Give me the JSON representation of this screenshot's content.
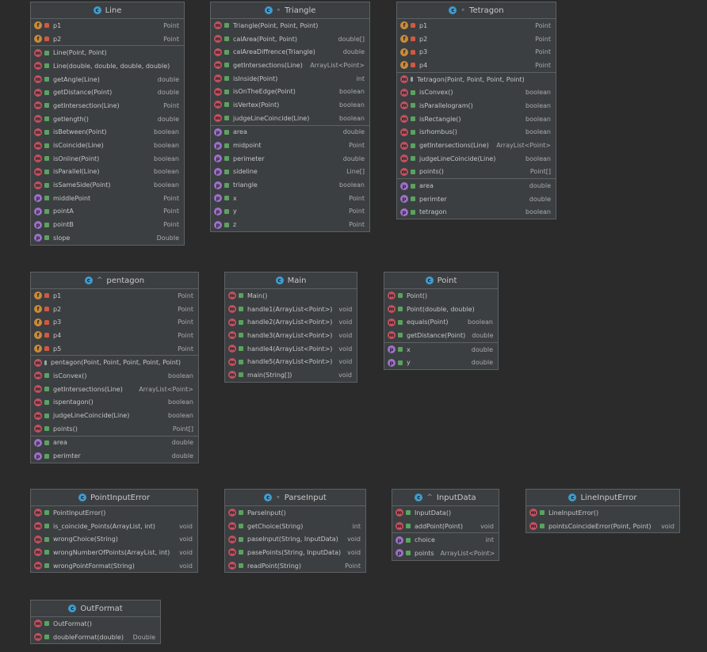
{
  "classes": [
    {
      "name": "Line",
      "modifier": "",
      "sections": [
        [
          {
            "icon": "f",
            "vis": "priv",
            "name": "p1",
            "type": "Point"
          },
          {
            "icon": "f",
            "vis": "priv",
            "name": "p2",
            "type": "Point"
          }
        ],
        [
          {
            "icon": "m",
            "vis": "pub",
            "name": "Line(Point, Point)",
            "type": ""
          },
          {
            "icon": "m",
            "vis": "pub",
            "name": "Line(double, double, double, double)",
            "type": ""
          },
          {
            "icon": "m",
            "vis": "pub",
            "name": "getAngle(Line)",
            "type": "double"
          },
          {
            "icon": "m",
            "vis": "pub",
            "name": "getDistance(Point)",
            "type": "double"
          },
          {
            "icon": "m",
            "vis": "pub",
            "name": "getIntersection(Line)",
            "type": "Point"
          },
          {
            "icon": "m",
            "vis": "pub",
            "name": "getlength()",
            "type": "double"
          },
          {
            "icon": "m",
            "vis": "pub",
            "name": "isBetween(Point)",
            "type": "boolean"
          },
          {
            "icon": "m",
            "vis": "pub",
            "name": "isCoincide(Line)",
            "type": "boolean"
          },
          {
            "icon": "m",
            "vis": "pub",
            "name": "isOnline(Point)",
            "type": "boolean"
          },
          {
            "icon": "m",
            "vis": "pub",
            "name": "isParallel(Line)",
            "type": "boolean"
          },
          {
            "icon": "m",
            "vis": "pub",
            "name": "isSameSide(Point)",
            "type": "boolean"
          },
          {
            "icon": "p",
            "vis": "pub",
            "name": "middlePoint",
            "type": "Point"
          },
          {
            "icon": "p",
            "vis": "pub",
            "name": "pointA",
            "type": "Point"
          },
          {
            "icon": "p",
            "vis": "pub",
            "name": "pointB",
            "type": "Point"
          },
          {
            "icon": "p",
            "vis": "pub",
            "name": "slope",
            "type": "Double"
          }
        ]
      ]
    },
    {
      "name": "Triangle",
      "modifier": "∘",
      "sections": [
        [
          {
            "icon": "m",
            "vis": "pub",
            "name": "Triangle(Point, Point, Point)",
            "type": ""
          },
          {
            "icon": "m",
            "vis": "pub",
            "name": "calArea(Point, Point)",
            "type": "double[]"
          },
          {
            "icon": "m",
            "vis": "pub",
            "name": "calAreaDiffrence(Triangle)",
            "type": "double"
          },
          {
            "icon": "m",
            "vis": "pub",
            "name": "getIntersections(Line)",
            "type": "ArrayList<Point>"
          },
          {
            "icon": "m",
            "vis": "pub",
            "name": "isInside(Point)",
            "type": "int"
          },
          {
            "icon": "m",
            "vis": "pub",
            "name": "isOnTheEdge(Point)",
            "type": "boolean"
          },
          {
            "icon": "m",
            "vis": "pub",
            "name": "isVertex(Point)",
            "type": "boolean"
          },
          {
            "icon": "m",
            "vis": "pub",
            "name": "judgeLineCoincide(Line)",
            "type": "boolean"
          }
        ],
        [
          {
            "icon": "p",
            "vis": "pub",
            "name": "area",
            "type": "double"
          },
          {
            "icon": "p",
            "vis": "pub",
            "name": "midpoint",
            "type": "Point"
          },
          {
            "icon": "p",
            "vis": "pub",
            "name": "perimeter",
            "type": "double"
          },
          {
            "icon": "p",
            "vis": "pub",
            "name": "sideline",
            "type": "Line[]"
          },
          {
            "icon": "p",
            "vis": "pub",
            "name": "triangle",
            "type": "boolean"
          },
          {
            "icon": "p",
            "vis": "pub",
            "name": "x",
            "type": "Point"
          },
          {
            "icon": "p",
            "vis": "pub",
            "name": "y",
            "type": "Point"
          },
          {
            "icon": "p",
            "vis": "pub",
            "name": "z",
            "type": "Point"
          }
        ]
      ]
    },
    {
      "name": "Tetragon",
      "modifier": "∘",
      "sections": [
        [
          {
            "icon": "f",
            "vis": "priv",
            "name": "p1",
            "type": "Point"
          },
          {
            "icon": "f",
            "vis": "priv",
            "name": "p2",
            "type": "Point"
          },
          {
            "icon": "f",
            "vis": "priv",
            "name": "p3",
            "type": "Point"
          },
          {
            "icon": "f",
            "vis": "priv",
            "name": "p4",
            "type": "Point"
          }
        ],
        [
          {
            "icon": "m",
            "vis": "pkg",
            "name": "Tetragon(Point, Point, Point, Point)",
            "type": ""
          },
          {
            "icon": "m",
            "vis": "pub",
            "name": "isConvex()",
            "type": "boolean"
          },
          {
            "icon": "m",
            "vis": "pub",
            "name": "isParallelogram()",
            "type": "boolean"
          },
          {
            "icon": "m",
            "vis": "pub",
            "name": "isRectangle()",
            "type": "boolean"
          },
          {
            "icon": "m",
            "vis": "pub",
            "name": "isrhombus()",
            "type": "boolean"
          },
          {
            "icon": "m",
            "vis": "pub",
            "name": "getIntersections(Line)",
            "type": "ArrayList<Point>"
          },
          {
            "icon": "m",
            "vis": "pub",
            "name": "judgeLineCoincide(Line)",
            "type": "boolean"
          },
          {
            "icon": "m",
            "vis": "pub",
            "name": "points()",
            "type": "Point[]"
          }
        ],
        [
          {
            "icon": "p",
            "vis": "pub",
            "name": "area",
            "type": "double"
          },
          {
            "icon": "p",
            "vis": "pub",
            "name": "perimter",
            "type": "double"
          },
          {
            "icon": "p",
            "vis": "pub",
            "name": "tetragon",
            "type": "boolean"
          }
        ]
      ]
    },
    {
      "name": "pentagon",
      "modifier": "^",
      "sections": [
        [
          {
            "icon": "f",
            "vis": "priv",
            "name": "p1",
            "type": "Point"
          },
          {
            "icon": "f",
            "vis": "priv",
            "name": "p2",
            "type": "Point"
          },
          {
            "icon": "f",
            "vis": "priv",
            "name": "p3",
            "type": "Point"
          },
          {
            "icon": "f",
            "vis": "priv",
            "name": "p4",
            "type": "Point"
          },
          {
            "icon": "f",
            "vis": "priv",
            "name": "p5",
            "type": "Point"
          }
        ],
        [
          {
            "icon": "m",
            "vis": "pkg",
            "name": "pentagon(Point, Point, Point, Point, Point)",
            "type": ""
          },
          {
            "icon": "m",
            "vis": "pub",
            "name": "isConvex()",
            "type": "boolean"
          },
          {
            "icon": "m",
            "vis": "pub",
            "name": "getIntersections(Line)",
            "type": "ArrayList<Point>"
          },
          {
            "icon": "m",
            "vis": "pub",
            "name": "ispentagon()",
            "type": "boolean"
          },
          {
            "icon": "m",
            "vis": "pub",
            "name": "judgeLineCoincide(Line)",
            "type": "boolean"
          },
          {
            "icon": "m",
            "vis": "pub",
            "name": "points()",
            "type": "Point[]"
          }
        ],
        [
          {
            "icon": "p",
            "vis": "pub",
            "name": "area",
            "type": "double"
          },
          {
            "icon": "p",
            "vis": "pub",
            "name": "perimter",
            "type": "double"
          }
        ]
      ]
    },
    {
      "name": "Main",
      "modifier": "",
      "sections": [
        [
          {
            "icon": "m",
            "vis": "pub",
            "name": "Main()",
            "type": ""
          },
          {
            "icon": "m",
            "vis": "pub",
            "name": "handle1(ArrayList<Point>)",
            "type": "void"
          },
          {
            "icon": "m",
            "vis": "pub",
            "name": "handle2(ArrayList<Point>)",
            "type": "void"
          },
          {
            "icon": "m",
            "vis": "pub",
            "name": "handle3(ArrayList<Point>)",
            "type": "void"
          },
          {
            "icon": "m",
            "vis": "pub",
            "name": "handle4(ArrayList<Point>)",
            "type": "void"
          },
          {
            "icon": "m",
            "vis": "pub",
            "name": "handle5(ArrayList<Point>)",
            "type": "void"
          },
          {
            "icon": "m",
            "vis": "pub",
            "name": "main(String[])",
            "type": "void"
          }
        ]
      ]
    },
    {
      "name": "Point",
      "modifier": "",
      "sections": [
        [
          {
            "icon": "m",
            "vis": "pub",
            "name": "Point()",
            "type": ""
          },
          {
            "icon": "m",
            "vis": "pub",
            "name": "Point(double, double)",
            "type": ""
          },
          {
            "icon": "m",
            "vis": "pub",
            "name": "equals(Point)",
            "type": "boolean"
          },
          {
            "icon": "m",
            "vis": "pub",
            "name": "getDistance(Point)",
            "type": "double"
          }
        ],
        [
          {
            "icon": "p",
            "vis": "pub",
            "name": "x",
            "type": "double"
          },
          {
            "icon": "p",
            "vis": "pub",
            "name": "y",
            "type": "double"
          }
        ]
      ]
    },
    {
      "name": "PointInputError",
      "modifier": "",
      "sections": [
        [
          {
            "icon": "m",
            "vis": "pub",
            "name": "PointInputError()",
            "type": ""
          },
          {
            "icon": "m",
            "vis": "pub",
            "name": "is_coincide_Points(ArrayList, int)",
            "type": "void"
          },
          {
            "icon": "m",
            "vis": "pub",
            "name": "wrongChoice(String)",
            "type": "void"
          },
          {
            "icon": "m",
            "vis": "pub",
            "name": "wrongNumberOfPoints(ArrayList, int)",
            "type": "void"
          },
          {
            "icon": "m",
            "vis": "pub",
            "name": "wrongPointFormat(String)",
            "type": "void"
          }
        ]
      ]
    },
    {
      "name": "ParseInput",
      "modifier": "∘",
      "sections": [
        [
          {
            "icon": "m",
            "vis": "pub",
            "name": "ParseInput()",
            "type": ""
          },
          {
            "icon": "m",
            "vis": "pub",
            "name": "getChoice(String)",
            "type": "int"
          },
          {
            "icon": "m",
            "vis": "pub",
            "name": "paseInput(String, InputData)",
            "type": "void"
          },
          {
            "icon": "m",
            "vis": "pub",
            "name": "pasePoints(String, InputData)",
            "type": "void"
          },
          {
            "icon": "m",
            "vis": "pub",
            "name": "readPoint(String)",
            "type": "Point"
          }
        ]
      ]
    },
    {
      "name": "InputData",
      "modifier": "^",
      "sections": [
        [
          {
            "icon": "m",
            "vis": "pub",
            "name": "InputData()",
            "type": ""
          },
          {
            "icon": "m",
            "vis": "pub",
            "name": "addPoint(Point)",
            "type": "void"
          }
        ],
        [
          {
            "icon": "p",
            "vis": "pub",
            "name": "choice",
            "type": "int"
          },
          {
            "icon": "p",
            "vis": "pub",
            "name": "points",
            "type": "ArrayList<Point>"
          }
        ]
      ]
    },
    {
      "name": "LineInputError",
      "modifier": "",
      "sections": [
        [
          {
            "icon": "m",
            "vis": "pub",
            "name": "LineInputError()",
            "type": ""
          },
          {
            "icon": "m",
            "vis": "pub",
            "name": "pointsCoincideError(Point, Point)",
            "type": "void"
          }
        ]
      ]
    },
    {
      "name": "OutFormat",
      "modifier": "",
      "sections": [
        [
          {
            "icon": "m",
            "vis": "pub",
            "name": "OutFormat()",
            "type": ""
          },
          {
            "icon": "m",
            "vis": "pub",
            "name": "doubleFormat(double)",
            "type": "Double"
          }
        ]
      ]
    }
  ],
  "icons": {
    "class_glyph": "c",
    "field_glyph": "f",
    "method_glyph": "m",
    "property_glyph": "p"
  },
  "colors": {
    "background": "#2b2b2b",
    "box": "#3c3f41",
    "border": "#5e6163",
    "class_icon": "#3f9bcf",
    "field_icon": "#c98b3a",
    "method_icon": "#c25160",
    "property_icon": "#9d70c9",
    "public": "#5aa35f",
    "private": "#d0593f"
  }
}
